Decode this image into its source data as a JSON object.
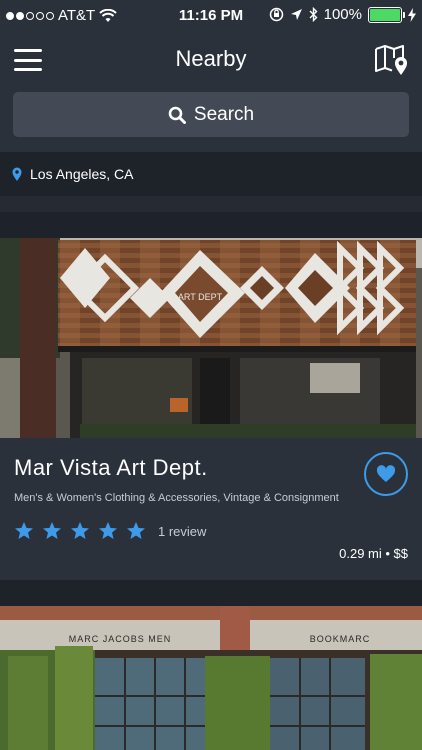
{
  "status_bar": {
    "carrier": "AT&T",
    "time": "11:16 PM",
    "battery_percent": "100%",
    "battery_level": 1.0,
    "signal_bars_filled": 2,
    "signal_bars_total": 5
  },
  "nav": {
    "title": "Nearby",
    "menu_icon": "hamburger-menu-icon",
    "map_icon": "map-pin-icon"
  },
  "search": {
    "label": "Search",
    "icon": "search-icon"
  },
  "location": {
    "text": "Los Angeles, CA",
    "icon": "location-pin-icon"
  },
  "listing": {
    "name": "Mar Vista Art Dept.",
    "tags": "Men's & Women's Clothing & Accessories, Vintage & Consignment",
    "rating": 5,
    "rating_max": 5,
    "review_text": "1 review",
    "distance_price": "0.29 mi • $$",
    "storefront_sign": "ART DEPT"
  },
  "next_listing": {
    "storefront_signs": [
      "MARC JACOBS MEN",
      "BOOKMARC"
    ]
  },
  "colors": {
    "accent": "#3d9be9",
    "nav_bg": "#2b313a",
    "page_bg": "#1e2229",
    "search_bg": "#434a55",
    "battery": "#4cd964"
  }
}
